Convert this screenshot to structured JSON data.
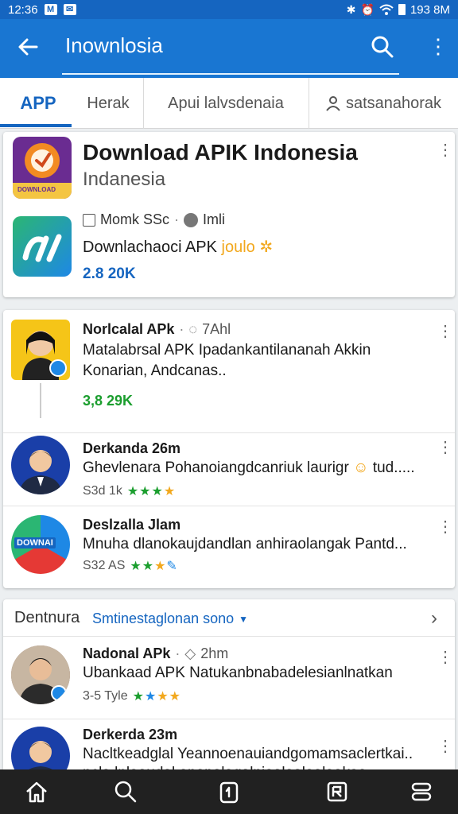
{
  "status": {
    "time": "12:36",
    "battery": "193 8M"
  },
  "appbar": {
    "title": "Inownlosia"
  },
  "tabs": [
    {
      "label": "APP"
    },
    {
      "label": "Herak"
    },
    {
      "label": "Apui lalvsdenaia"
    },
    {
      "label": "satsanahorak"
    }
  ],
  "featured": {
    "title": "Download APIK Indonesia",
    "subtitle": "Indanesia",
    "app_icon_text": "DOWNLOAD",
    "meta_left": "Momk SSc",
    "meta_right": "Imli",
    "desc": "Downlachaoci APK",
    "desc_tag": "joulo",
    "count": "2.8 20K"
  },
  "posts": [
    {
      "title": "Norlcalal APk",
      "meta": "7Ahl",
      "text1": "Matalabrsal APK Ipadankantilananah Akkin",
      "text2": "Konarian, Andcanas..",
      "count": "3,8 29K"
    },
    {
      "title": "Derkanda 26m",
      "text1": "Ghevlenara Pohanoiangdcanriuk laurigr",
      "text1_tail": "tud.....",
      "count": "S3d 1k"
    },
    {
      "title": "Deslzalla Jlam",
      "badge": "DOWNAI",
      "text1": "Mnuha dlanokaujdandlan anhiraolangak Pantd...",
      "count": "S32 AS"
    }
  ],
  "section": {
    "title": "Dentnura",
    "link": "Smtinestaglonan sono"
  },
  "posts2": [
    {
      "title": "Nadonal APk",
      "meta": "2hm",
      "text1": "Ubankaad APK Natukanbnabadelesianlnatkan",
      "count": "3-5 Tyle"
    },
    {
      "title": "Derkerda 23m",
      "text1": "Nacltkeadglal Yeannoenauiandgomamsaclertkai..",
      "text2": "ncla lnlaaudal anapalaqalniaalaalaalaakaa"
    }
  ],
  "colors": {
    "primary": "#1976d2",
    "status_bar": "#1565c0",
    "star_green": "#1b9e2e",
    "star_blue": "#1e88e5",
    "star_orange": "#f2a81d"
  }
}
